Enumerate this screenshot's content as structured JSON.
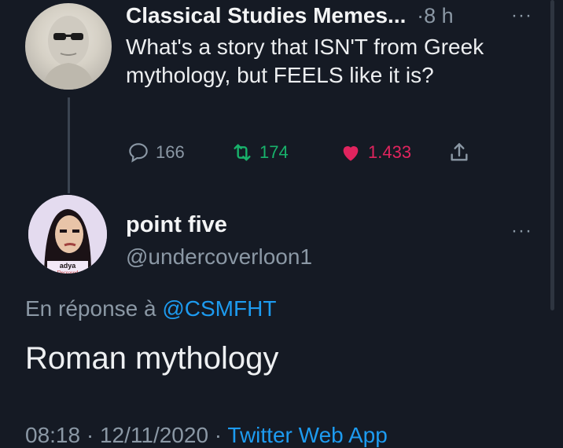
{
  "tweet": {
    "author": "Classical Studies Memes...",
    "time": "·8 h",
    "more": "···",
    "text": "What's a story that ISN'T from Greek mythology, but FEELS like it is?",
    "replies": "166",
    "retweets": "174",
    "likes": "1.433"
  },
  "reply": {
    "display_name": "point five",
    "handle": "@undercoverloon1",
    "more": "···",
    "avatar_label_1": "adya",
    "avatar_label_2": "Deceased",
    "in_reply_prefix": "En réponse à",
    "in_reply_handle": "@CSMFHT",
    "text": "Roman mythology",
    "timestamp": "08:18 · 12/11/2020 ·",
    "client": "Twitter Web App"
  },
  "colors": {
    "background": "#151a24",
    "secondary_text": "#8b98a5",
    "retweet": "#18b26b",
    "like": "#e0245e",
    "link": "#1d9bf0"
  }
}
